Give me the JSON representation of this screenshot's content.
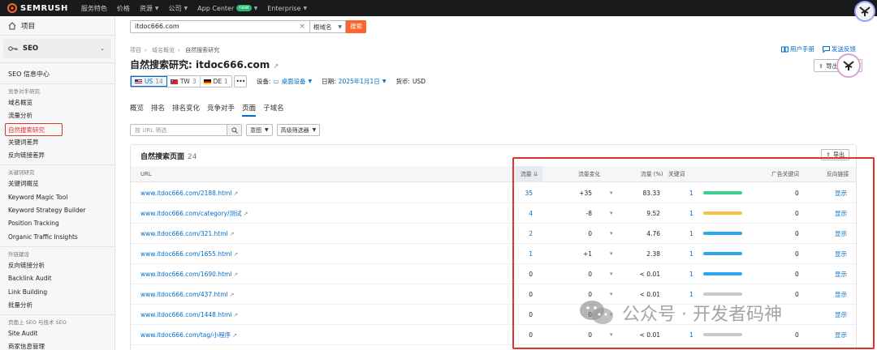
{
  "topnav": {
    "brand": "SEMRUSH",
    "items": [
      {
        "label": "服务特色",
        "caret": false
      },
      {
        "label": "价格",
        "caret": false
      },
      {
        "label": "资源",
        "caret": true
      },
      {
        "label": "公司",
        "caret": true
      },
      {
        "label": "App Center",
        "caret": true,
        "badge": "new"
      },
      {
        "label": "Enterprise",
        "caret": true
      }
    ]
  },
  "sidebar": {
    "home": "项目",
    "seo": "SEO",
    "seo_center": "SEO 信息中心",
    "sections": [
      {
        "title": "竞争对手研究",
        "items": [
          "域名概览",
          "流量分析",
          "自然搜索研究",
          "关键词差异",
          "反向链接差异"
        ]
      },
      {
        "title": "关键词研究",
        "items": [
          "关键词概览",
          "Keyword Magic Tool",
          "Keyword Strategy Builder",
          "Position Tracking",
          "Organic Traffic Insights"
        ]
      },
      {
        "title": "外链建设",
        "items": [
          "反向链接分析",
          "Backlink Audit",
          "Link Building",
          "批量分析"
        ]
      },
      {
        "title": "页面上 SEO 与技术 SEO",
        "items": [
          "Site Audit",
          "商家信息管理"
        ]
      }
    ],
    "active_item": "自然搜索研究"
  },
  "search": {
    "value": "itdoc666.com",
    "scope": "根域名",
    "button": "搜索"
  },
  "breadcrumb": [
    "项目",
    "域名概览",
    "自然搜索研究"
  ],
  "top_links": {
    "manual": "用户手册",
    "feedback": "发送反馈"
  },
  "export_top": "导出 PDF",
  "title": {
    "prefix": "自然搜索研究:",
    "domain": "itdoc666.com"
  },
  "databases": [
    {
      "code": "US",
      "count": "14",
      "active": true
    },
    {
      "code": "TW",
      "count": "3",
      "active": false
    },
    {
      "code": "DE",
      "count": "1",
      "active": false
    }
  ],
  "meta": {
    "device_label": "设备:",
    "device_value": "桌面设备",
    "date_label": "日期:",
    "date_value": "2025年1月1日",
    "currency_label": "货币:",
    "currency_value": "USD"
  },
  "tabs": [
    "概览",
    "排名",
    "排名变化",
    "竞争对手",
    "页面",
    "子域名"
  ],
  "active_tab": "页面",
  "filters": {
    "url_placeholder": "按 URL 筛选",
    "intent": "意图",
    "advanced": "高级筛选器"
  },
  "panel": {
    "title": "自然搜索页面",
    "count": "24",
    "export": "导出",
    "columns": {
      "url": "URL",
      "traffic": "流量",
      "traffic_change": "流量变化",
      "traffic_pct": "流量 (%)",
      "keywords": "关键词",
      "ad_keywords": "广告关键词",
      "backlinks": "反向链接"
    },
    "rows": [
      {
        "url": "www.itdoc666.com/2188.html",
        "traffic": "35",
        "change": "+35",
        "pct": "83.33",
        "kw": "1",
        "ads": "0",
        "backlinks": "显示",
        "bar": "green",
        "traffic_link": true
      },
      {
        "url": "www.itdoc666.com/category/测试",
        "traffic": "4",
        "change": "-8",
        "pct": "9.52",
        "kw": "1",
        "ads": "0",
        "backlinks": "显示",
        "bar": "yellow",
        "traffic_link": true
      },
      {
        "url": "www.itdoc666.com/321.html",
        "traffic": "2",
        "change": "0",
        "pct": "4.76",
        "kw": "1",
        "ads": "0",
        "backlinks": "显示",
        "bar": "blue",
        "traffic_link": true
      },
      {
        "url": "www.itdoc666.com/1655.html",
        "traffic": "1",
        "change": "+1",
        "pct": "2.38",
        "kw": "1",
        "ads": "0",
        "backlinks": "显示",
        "bar": "blue",
        "traffic_link": true
      },
      {
        "url": "www.itdoc666.com/1690.html",
        "traffic": "0",
        "change": "0",
        "pct": "< 0.01",
        "kw": "1",
        "ads": "0",
        "backlinks": "显示",
        "bar": "blue",
        "traffic_link": false
      },
      {
        "url": "www.itdoc666.com/437.html",
        "traffic": "0",
        "change": "0",
        "pct": "< 0.01",
        "kw": "1",
        "ads": "0",
        "backlinks": "显示",
        "bar": "gray",
        "traffic_link": false
      },
      {
        "url": "www.itdoc666.com/1448.html",
        "traffic": "0",
        "change": "0",
        "pct": "",
        "kw": "",
        "ads": "",
        "backlinks": "显示",
        "bar": "",
        "traffic_link": false
      },
      {
        "url": "www.itdoc666.com/tag/小程序",
        "traffic": "0",
        "change": "0",
        "pct": "< 0.01",
        "kw": "1",
        "ads": "0",
        "backlinks": "显示",
        "bar": "gray",
        "traffic_link": false
      }
    ]
  },
  "colors": {
    "green": "#3ccf91",
    "yellow": "#f6c343",
    "blue": "#2ca8f0",
    "gray": "#c6c9ce",
    "accent": "#ff642d",
    "link": "#006dca",
    "highlight": "#e0312b"
  },
  "watermark": "公众号 · 开发者码神"
}
